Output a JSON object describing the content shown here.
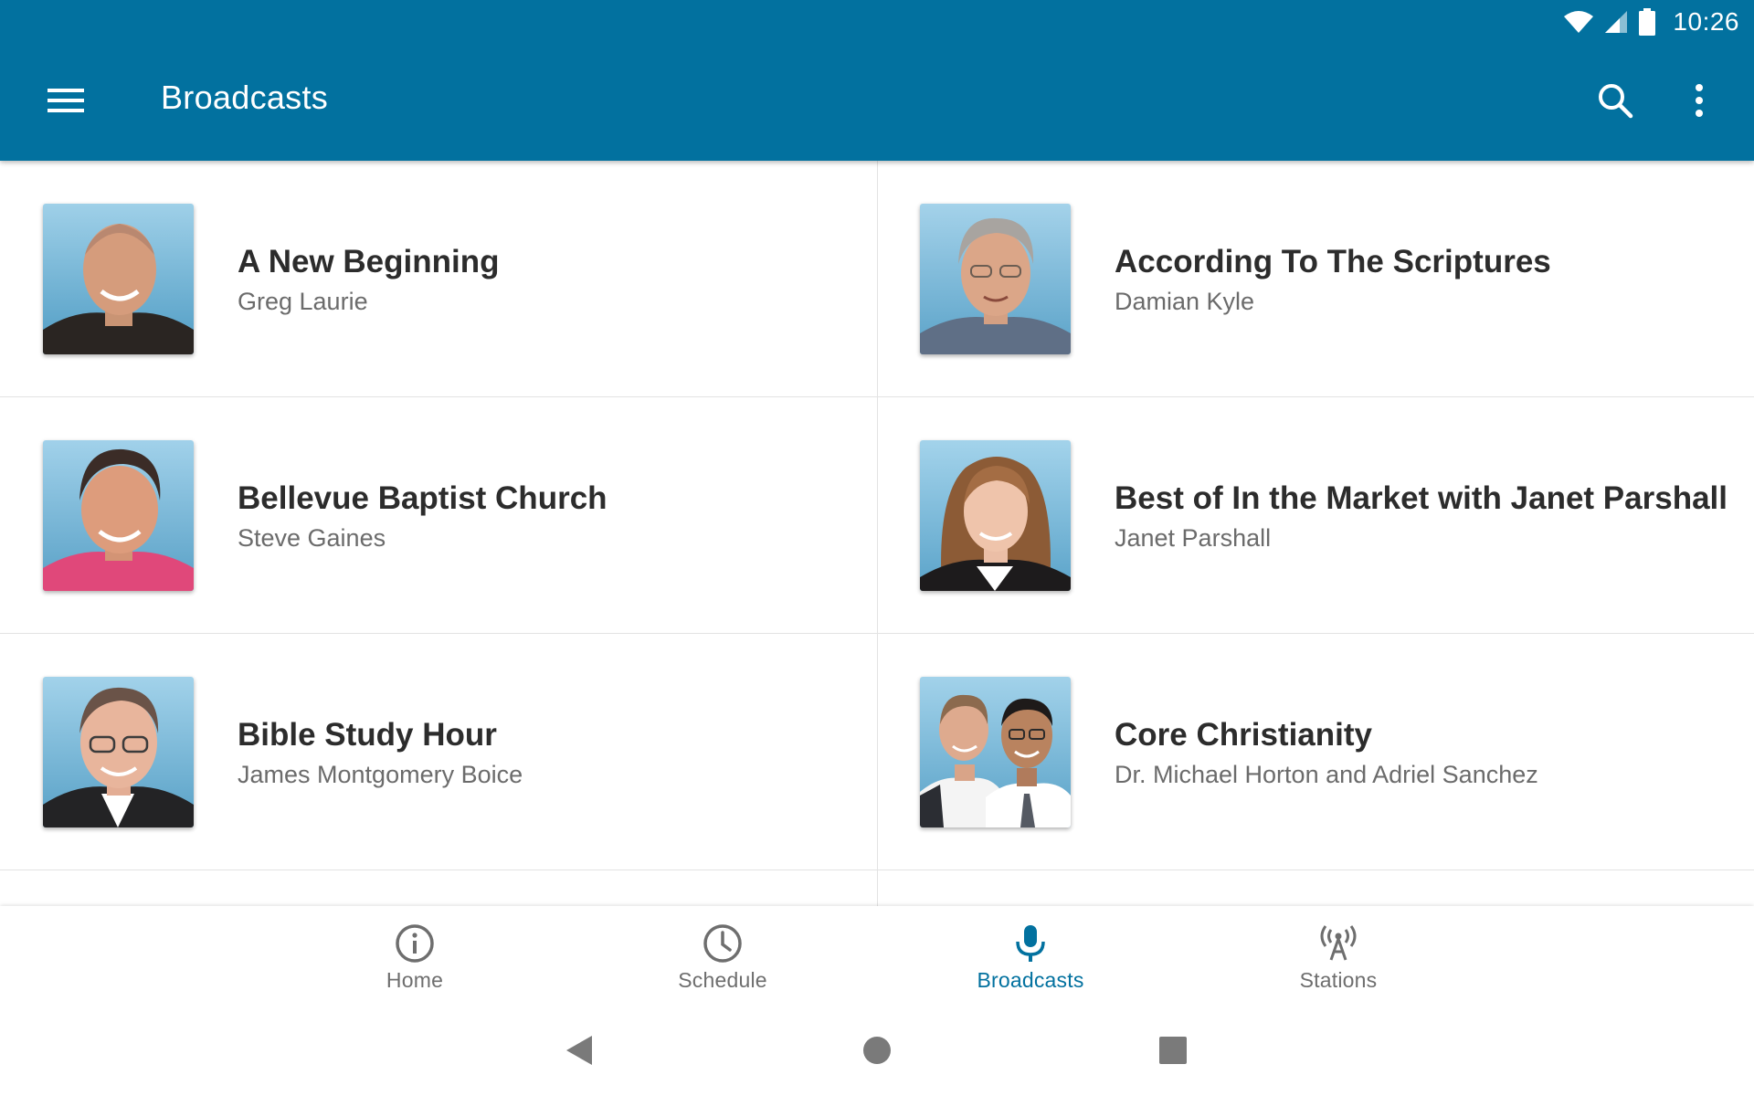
{
  "status_bar": {
    "time": "10:26",
    "icons": [
      "wifi-icon",
      "cell-signal-icon",
      "battery-icon"
    ]
  },
  "app_bar": {
    "title": "Broadcasts",
    "menu_icon": "hamburger-menu-icon",
    "search_icon": "search-icon",
    "more_icon": "more-vert-icon"
  },
  "broadcasts": [
    {
      "title": "A New Beginning",
      "host": "Greg Laurie"
    },
    {
      "title": "According To The Scriptures",
      "host": "Damian Kyle"
    },
    {
      "title": "Bellevue Baptist Church",
      "host": "Steve Gaines"
    },
    {
      "title": "Best of In the Market with Janet Parshall",
      "host": "Janet Parshall"
    },
    {
      "title": "Bible Study Hour",
      "host": "James Montgomery Boice"
    },
    {
      "title": "Core Christianity",
      "host": "Dr. Michael Horton and Adriel Sanchez"
    }
  ],
  "bottom_nav": {
    "active": "Broadcasts",
    "items": [
      {
        "label": "Home",
        "icon": "info-icon"
      },
      {
        "label": "Schedule",
        "icon": "clock-icon"
      },
      {
        "label": "Broadcasts",
        "icon": "microphone-icon"
      },
      {
        "label": "Stations",
        "icon": "radio-tower-icon"
      }
    ]
  },
  "system_nav": {
    "icons": [
      "back-icon",
      "home-icon",
      "recents-icon"
    ]
  },
  "colors": {
    "primary": "#02719f",
    "active_nav": "#02719f",
    "inactive_nav": "#6e6e6e",
    "title_text": "#2c2c2c",
    "subtitle_text": "#6b6b6b",
    "divider": "#e3e3e3"
  }
}
